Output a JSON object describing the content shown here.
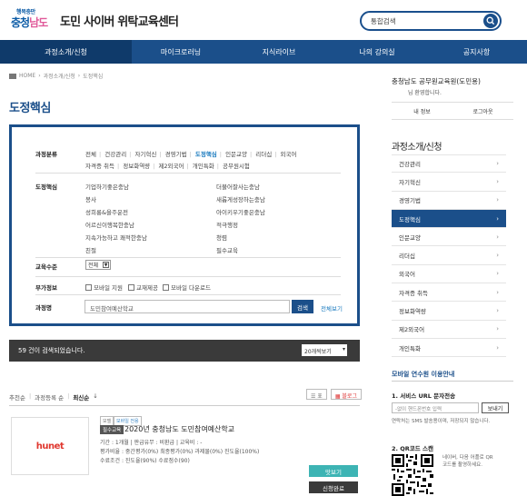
{
  "header": {
    "logo_small": "행복충만",
    "logo_big_1": "충청",
    "logo_big_2": "남도",
    "site_title": "도민 사이버 위탁교육센터",
    "search_value": "통합검색"
  },
  "nav": [
    {
      "label": "과정소개/신청",
      "active": true
    },
    {
      "label": "마이크로러닝",
      "active": false
    },
    {
      "label": "지식라이브",
      "active": false
    },
    {
      "label": "나의 강의실",
      "active": false
    },
    {
      "label": "공지사항",
      "active": false
    }
  ],
  "breadcrumb": {
    "home": "HOME",
    "level1": "과정소개/신청",
    "level2": "도정핵심"
  },
  "page_title": "도정핵심",
  "filter": {
    "category_label": "과정분류",
    "categories": [
      "전체",
      "건강관리",
      "자기혁신",
      "경영기법",
      "도정핵심",
      "인문교양",
      "리더십",
      "외국어",
      "자격증 취득",
      "정보화역량",
      "제2외국어",
      "개인특화",
      "공무원시험"
    ],
    "active_category": "도정핵심",
    "core_label": "도정핵심",
    "core_left": [
      "기업하기좋은충남",
      "봉사",
      "성희롱&을주운전",
      "어르신이행복한충남",
      "지속가능하고 쾌적한충남",
      "친절"
    ],
    "core_right": [
      "더불어잘사는충남",
      "새롭게성장하는충남",
      "아이키우기좋은충남",
      "적극행정",
      "청렴",
      "필수교육"
    ],
    "level_label": "교육수준",
    "level_value": "전체",
    "extra_label": "부가정보",
    "extra_options": [
      "모바일 지원",
      "교재제공",
      "모바일 다운로드"
    ],
    "course_label": "과정명",
    "course_value": "도민참여예산학교",
    "search_button": "검색",
    "all_link": "전체보기"
  },
  "results": {
    "count_text": "59 건이 검색되었습니다.",
    "per_page": "20개씩보기"
  },
  "sort": {
    "options": [
      "추천순",
      "과정등록 순",
      "최신순"
    ],
    "active": "최신순"
  },
  "view_buttons": {
    "list": "표",
    "blog": "블로그"
  },
  "course": {
    "thumb_text": "hunet",
    "tags": [
      "모델",
      "모바일 전용"
    ],
    "badge": "필수교육",
    "title": "2020년 충청남도 도민참여예산학교",
    "meta1": "기간 : 1개월  |  판급유무 : 비환급  |  교육비 : -",
    "meta2": "평가비율 : 중간평가(0%) 최종평가(0%) 과제물(0%) 진도율(100%)",
    "meta3": "수료조건 : 진도율(90%) 수료점수(90)",
    "view_button": "맛보기",
    "apply_button": "신청완료"
  },
  "sidebar": {
    "org": "충청남도 공무원교육원(도민용)",
    "welcome": "님 환영합니다.",
    "my_info": "내 정보",
    "logout": "로그아웃",
    "section_title": "과정소개/신청",
    "menu": [
      {
        "label": "건강관리",
        "active": false
      },
      {
        "label": "자기혁신",
        "active": false
      },
      {
        "label": "경영기법",
        "active": false
      },
      {
        "label": "도정핵심",
        "active": true
      },
      {
        "label": "인문교양",
        "active": false
      },
      {
        "label": "리더십",
        "active": false
      },
      {
        "label": "외국어",
        "active": false
      },
      {
        "label": "자격증 취득",
        "active": false
      },
      {
        "label": "정보화역량",
        "active": false
      },
      {
        "label": "제2외국어",
        "active": false
      },
      {
        "label": "개인특화",
        "active": false
      }
    ],
    "mobile_title": "모바일 연수원 이용안내",
    "sms_title": "1. 서비스 URL 문자전송",
    "phone_placeholder": "-없이 핸드폰번호 입력",
    "send_button": "보내기",
    "sms_note": "연락처는 SMS 발송용이며, 저장되지 않습니다.",
    "qr_title": "2. QR코드 스캔",
    "qr_note": "네이버, 다음 어플로 QR코드를 촬영하세요."
  },
  "colors": {
    "brand": "#1b4f8a",
    "accent": "#1b7bbf",
    "teal": "#3db4b4"
  }
}
